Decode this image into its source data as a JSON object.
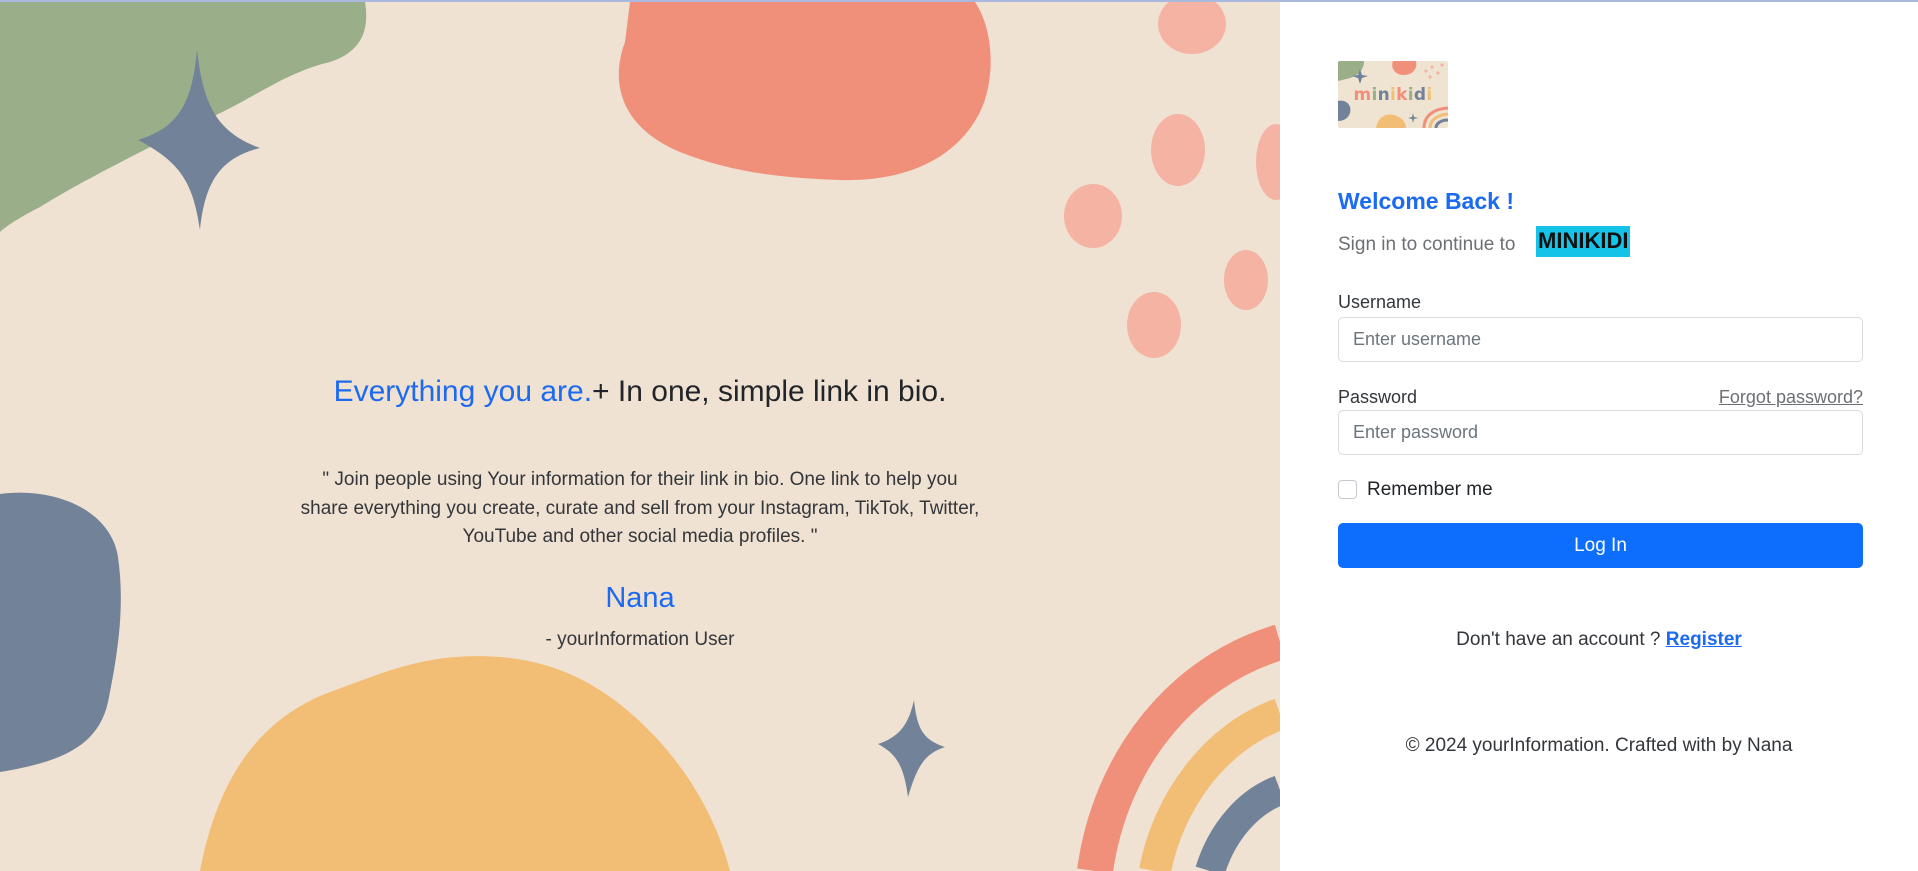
{
  "hero": {
    "headline_accent": "Everything you are.",
    "headline_rest": "+ In one, simple link in bio.",
    "quote_lines": [
      "\" Join people using Your information for their link in bio. One link to help you",
      "share everything you create, curate and sell from your Instagram, TikTok, Twitter,",
      "YouTube and other social media profiles. \""
    ],
    "author": "Nana",
    "author_role": "- yourInformation User"
  },
  "login": {
    "logo_text": "minikidi",
    "welcome": "Welcome Back !",
    "subtitle": "Sign in to continue to",
    "brand": "MINIKIDI",
    "username_label": "Username",
    "username_placeholder": "Enter username",
    "username_value": "",
    "password_label": "Password",
    "password_placeholder": "Enter password",
    "password_value": "",
    "forgot_link": "Forgot password?",
    "remember_label": "Remember me",
    "remember_checked": false,
    "login_button": "Log In",
    "no_account_text": "Don't have an account ?",
    "register_link": "Register",
    "footer": "© 2024 yourInformation. Crafted with by Nana"
  },
  "colors": {
    "accent": "#1b6af0",
    "button": "#0d6efd",
    "brand_highlight": "#16c3e8",
    "hero_background": "#f0e2d3",
    "coral": "#f0907b",
    "sage": "#9bae8a",
    "slate": "#728299",
    "mustard": "#f2bd74",
    "pink": "#f4b3a3"
  },
  "icons": {
    "sparkle": "four-point-star-icon"
  }
}
